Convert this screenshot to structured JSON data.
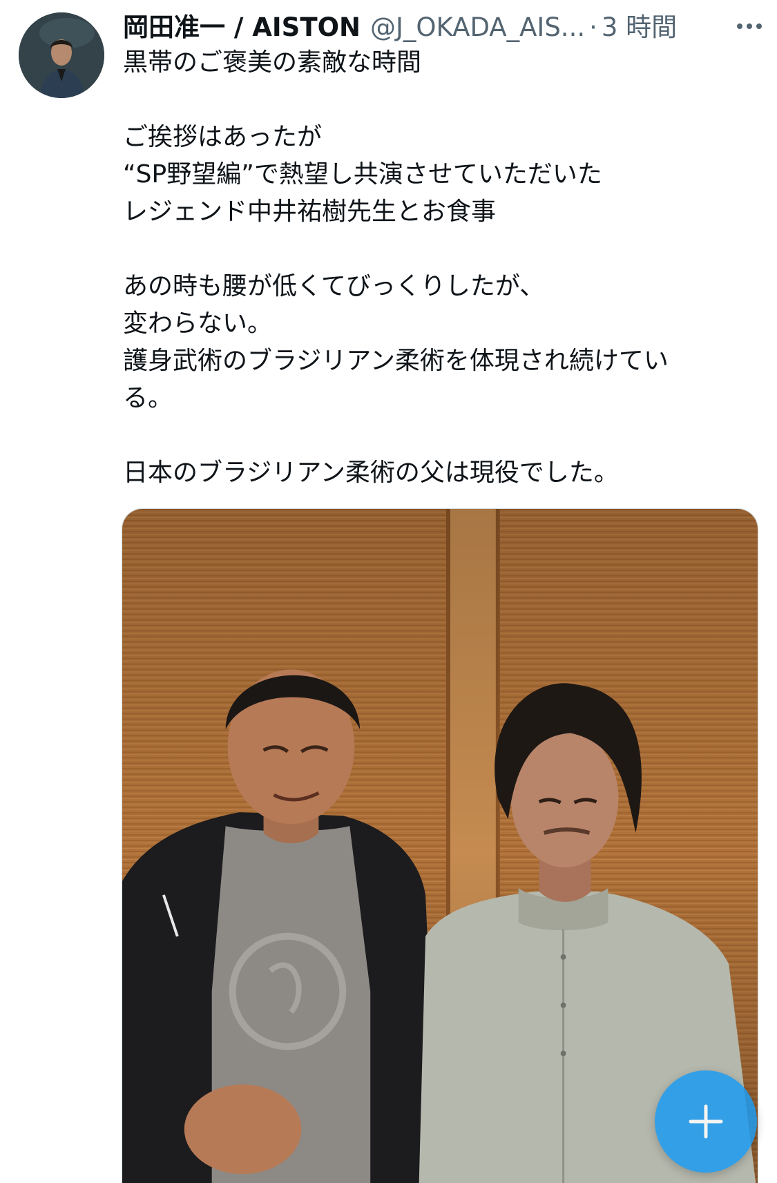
{
  "tweet": {
    "author": {
      "display_name": "岡田准一 / AISTON",
      "handle": "@J_OKADA_AIS...",
      "avatar_icon": "profile-photo"
    },
    "separator": "·",
    "timestamp": "3 時間",
    "more_icon": "ellipsis-icon",
    "text_lines": [
      "黒帯のご褒美の素敵な時間",
      "",
      "ご挨拶はあったが",
      "“SP野望編”で熱望し共演させていただいた",
      "レジェンド中井祐樹先生とお食事",
      "",
      "あの時も腰が低くてびっくりしたが、",
      "変わらない。",
      "護身武術のブラジリアン柔術を体現され続けてい",
      "る。",
      "",
      "日本のブラジリアン柔術の父は現役でした。"
    ],
    "media": {
      "icon": "photo-two-men-wood-wall"
    },
    "compose_button": {
      "icon": "plus-icon",
      "color": "#1d9bf0"
    }
  }
}
